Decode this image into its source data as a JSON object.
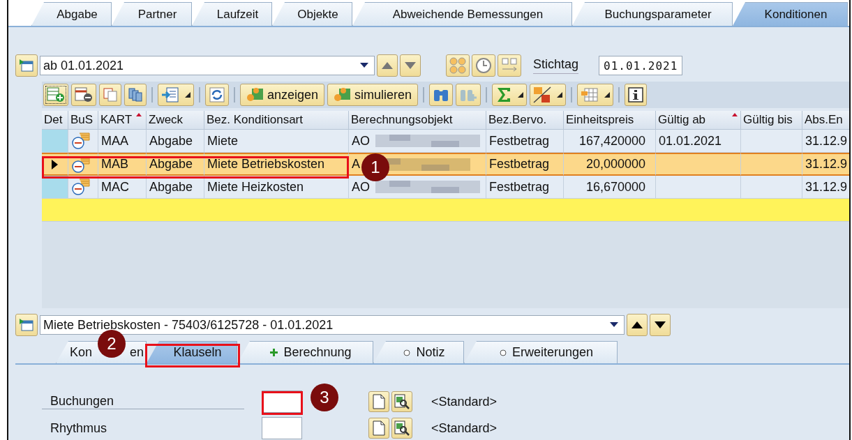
{
  "top_tabs": [
    {
      "label": "Abgabe",
      "selected": false
    },
    {
      "label": "Partner",
      "selected": false
    },
    {
      "label": "Laufzeit",
      "selected": false
    },
    {
      "label": "Objekte",
      "selected": false
    },
    {
      "label": "Abweichende Bemessungen",
      "selected": false
    },
    {
      "label": "Buchungsparameter",
      "selected": false
    },
    {
      "label": "Konditionen",
      "selected": true
    }
  ],
  "period_selector": {
    "value": "ab 01.01.2021"
  },
  "stichtag": {
    "label": "Stichtag",
    "value": "01.01.2021"
  },
  "toolbar": {
    "text_buttons": [
      "anzeigen",
      "simulieren"
    ]
  },
  "table": {
    "columns": [
      {
        "label": "Det",
        "sorted": false
      },
      {
        "label": "BuS",
        "sorted": false
      },
      {
        "label": "KART",
        "sorted": true
      },
      {
        "label": "Zweck",
        "sorted": false
      },
      {
        "label": "Bez. Konditionsart",
        "sorted": false
      },
      {
        "label": "Berechnungsobjekt",
        "sorted": false
      },
      {
        "label": "Bez.Bervo.",
        "sorted": false
      },
      {
        "label": "Einheitspreis",
        "sorted": false
      },
      {
        "label": "Gültig ab",
        "sorted": true
      },
      {
        "label": "Gültig bis",
        "sorted": false
      },
      {
        "label": "Abs.En",
        "sorted": false
      }
    ],
    "rows": [
      {
        "selected": false,
        "kart": "MAA",
        "zweck": "Abgabe",
        "bez": "Miete",
        "objekt": "AO",
        "bervo": "Festbetrag",
        "preis": "167,420000",
        "ab": "01.01.2021",
        "abs": "31.12.9"
      },
      {
        "selected": true,
        "kart": "MAB",
        "zweck": "Abgabe",
        "bez": "Miete Betriebskosten",
        "objekt": "A",
        "bervo": "Festbetrag",
        "preis": "20,000000",
        "abs": "31.12.9"
      },
      {
        "selected": false,
        "kart": "MAC",
        "zweck": "Abgabe",
        "bez": "Miete Heizkosten",
        "objekt": "AO",
        "bervo": "Festbetrag",
        "preis": "16,670000",
        "abs": "31.12.9"
      }
    ]
  },
  "detail_selector": {
    "value": "Miete Betriebskosten - 75403/6125728 - 01.01.2021"
  },
  "detail_tabs": [
    {
      "label": "Kon",
      "label_tail": "en",
      "selected": false
    },
    {
      "label": "Klauseln",
      "selected": true
    },
    {
      "label": "Berechnung",
      "selected": false,
      "kind": "plus"
    },
    {
      "label": "Notiz",
      "selected": false,
      "kind": "circle"
    },
    {
      "label": "Erweiterungen",
      "selected": false,
      "kind": "circle"
    }
  ],
  "fields": [
    {
      "label": "Buchungen",
      "default": "<Standard>"
    },
    {
      "label": "Rhythmus",
      "default": "<Standard>"
    }
  ],
  "annotations": [
    {
      "number": "1",
      "frame": true
    },
    {
      "number": "2",
      "frame": true
    },
    {
      "number": "3",
      "frame": true
    }
  ]
}
